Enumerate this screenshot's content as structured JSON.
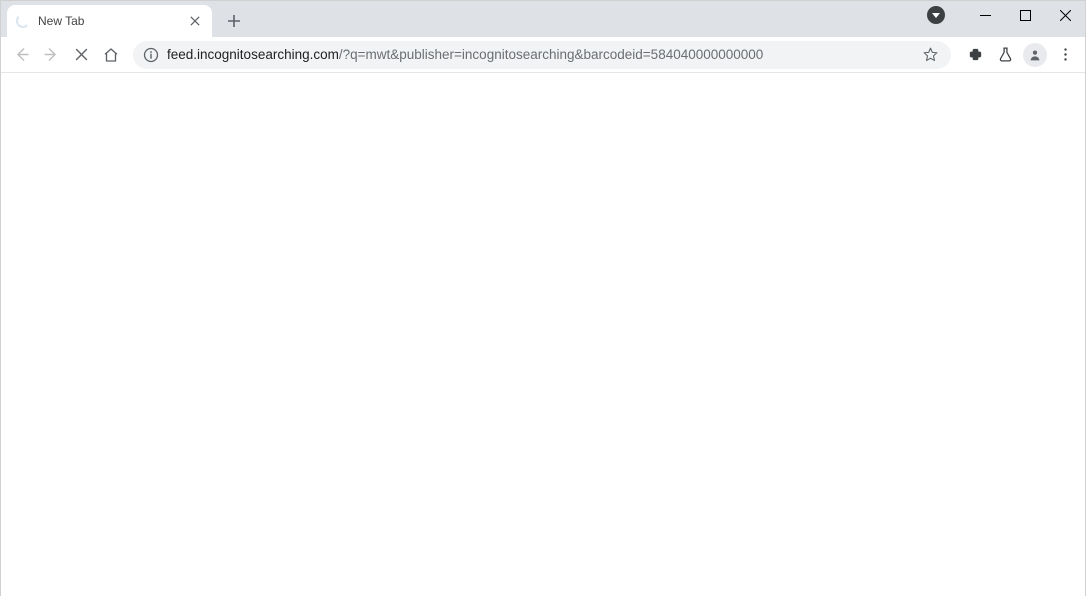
{
  "window": {
    "title": "New Tab"
  },
  "tabs": [
    {
      "title": "New Tab",
      "loading": true
    }
  ],
  "omnibox": {
    "host": "feed.incognitosearching.com",
    "path": "/?q=mwt&publisher=incognitosearching&barcodeid=584040000000000"
  },
  "nav": {
    "back_enabled": false,
    "forward_enabled": false,
    "stop_reload_showing": "stop"
  }
}
